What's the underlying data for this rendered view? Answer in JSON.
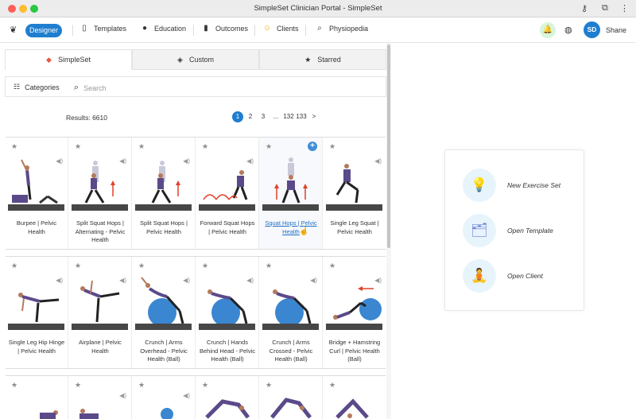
{
  "window": {
    "title": "SimpleSet Clinician Portal - SimpleSet"
  },
  "nav": {
    "designer": "Designer",
    "items": [
      {
        "label": "Templates",
        "icon": "document-icon"
      },
      {
        "label": "Education",
        "icon": "apple-icon"
      },
      {
        "label": "Outcomes",
        "icon": "bar-chart-icon"
      },
      {
        "label": "Clients",
        "icon": "smiley-icon"
      },
      {
        "label": "Physiopedia",
        "icon": "search-icon"
      }
    ],
    "user_initials": "SD",
    "user_name": "Shane"
  },
  "tabs": [
    {
      "label": "SimpleSet",
      "active": true
    },
    {
      "label": "Custom",
      "active": false
    },
    {
      "label": "Starred",
      "active": false
    }
  ],
  "search": {
    "categories": "Categories",
    "placeholder": "Search"
  },
  "results": {
    "text": "Results: 6610"
  },
  "pagination": [
    "1",
    "2",
    "3",
    "...",
    "132",
    "133",
    ">"
  ],
  "exercises_row1": [
    "Burpee | Pelvic Health",
    "Split Squat Hops | Alternating - Pelvic Health",
    "Split Squat Hops | Pelvic Health",
    "Forward Squat Hops | Pelvic Health",
    "Squat Hops | Pelvic Health",
    "Single Leg Squat | Pelvic Health"
  ],
  "exercises_row2": [
    "Single Leg Hip Hinge | Pelvic Health",
    "Airplane | Pelvic Health",
    "Crunch | Arms Overhead - Pelvic Health (Ball)",
    "Crunch | Hands Behind Head - Pelvic Health (Ball)",
    "Crunch | Arms Crossed - Pelvic Health (Ball)",
    "Bridge + Hamstring Curl | Pelvic Health (Ball)"
  ],
  "quick_actions": [
    {
      "label": "New Exercise Set",
      "icon": "lightbulb-icon"
    },
    {
      "label": "Open Template",
      "icon": "template-icon"
    },
    {
      "label": "Open Client",
      "icon": "client-icon"
    }
  ],
  "colors": {
    "brand": "#1f7ed0",
    "bell_bg": "#d6f5dc"
  }
}
